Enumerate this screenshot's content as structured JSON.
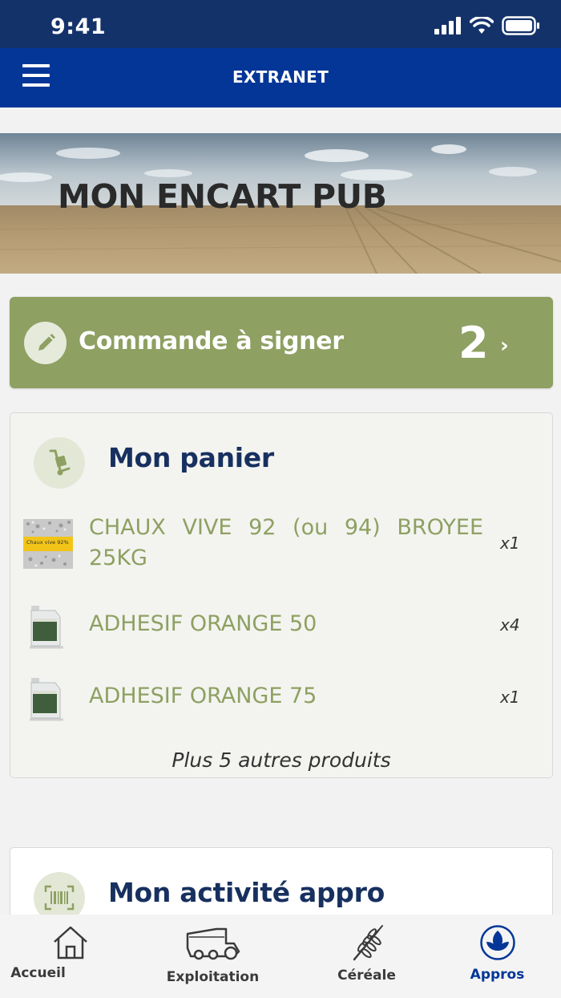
{
  "status_bar": {
    "time": "9:41"
  },
  "navbar": {
    "title": "EXTRANET"
  },
  "banner": {
    "title": "MON ENCART PUB"
  },
  "sign_card": {
    "label": "Commande à signer",
    "count": "2",
    "chevron": "›"
  },
  "cart": {
    "title": "Mon panier",
    "items": [
      {
        "name": "CHAUX VIVE 92 (ou 94) BROYEE 25KG",
        "qty": "x1",
        "thumb_text": "Chaux vive 92%"
      },
      {
        "name": "ADHESIF ORANGE 50",
        "qty": "x4"
      },
      {
        "name": "ADHESIF ORANGE 75",
        "qty": "x1"
      }
    ],
    "more": "Plus 5 autres produits"
  },
  "activity": {
    "title": "Mon activité appro"
  },
  "tabs": [
    {
      "label": "Accueil",
      "icon": "home-icon"
    },
    {
      "label": "Exploitation",
      "icon": "tractor-icon"
    },
    {
      "label": "Céréale",
      "icon": "wheat-icon"
    },
    {
      "label": "Appros",
      "icon": "leaf-icon",
      "active": true
    }
  ],
  "colors": {
    "navbar": "#033697",
    "status_bar": "#14326a",
    "accent_green": "#8ea062",
    "title_navy": "#17305f"
  }
}
